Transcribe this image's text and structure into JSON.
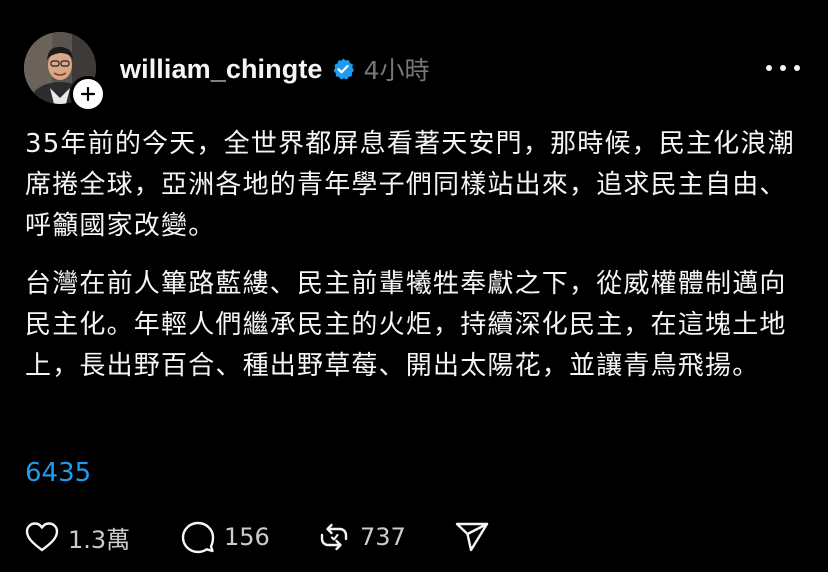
{
  "post": {
    "username": "william_chingte",
    "timestamp": "4小時",
    "paragraphs": [
      "35年前的今天，全世界都屏息看著天安門，那時候，民主化浪潮席捲全球，亞洲各地的青年學子們同樣站出來，追求民主自由、呼籲國家改變。",
      "台灣在前人篳路藍縷、民主前輩犧牲奉獻之下，從威權體制邁向民主化。年輕人們繼承民主的火炬，持續深化民主，在這塊土地上，長出野百合、種出野草莓、開出太陽花，並讓青鳥飛揚。"
    ],
    "tag": "6435",
    "actions": {
      "likes": "1.3萬",
      "replies": "156",
      "reposts": "737"
    }
  },
  "icons": {
    "verified": "verified-badge-icon",
    "follow": "plus-icon",
    "more": "more-horizontal-icon",
    "like": "heart-icon",
    "reply": "comment-bubble-icon",
    "repost": "repost-icon",
    "share": "send-icon"
  },
  "colors": {
    "background": "#000000",
    "text": "#f3f5f7",
    "muted": "#777777",
    "link": "#1f9bf0",
    "verified": "#1d9bf0"
  }
}
